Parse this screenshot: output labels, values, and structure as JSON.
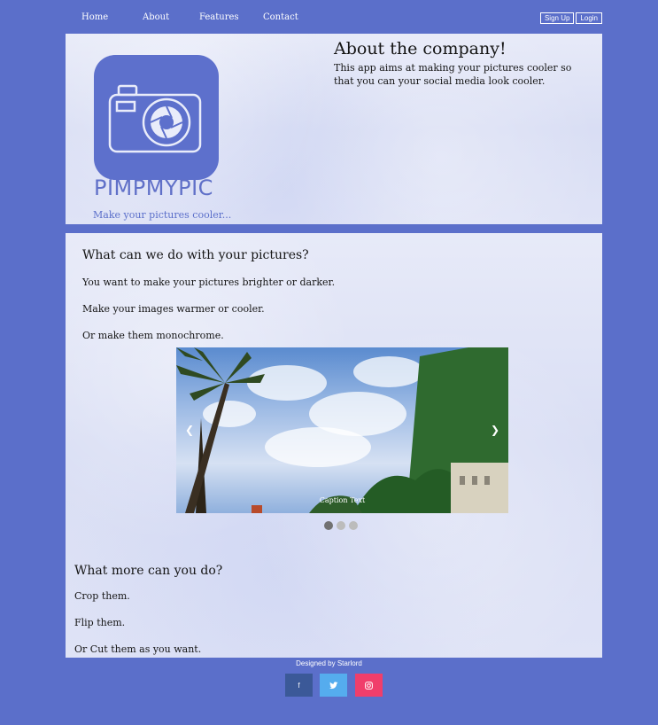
{
  "nav": {
    "items": [
      "Home",
      "About",
      "Features",
      "Contact"
    ],
    "signup_label": "Sign Up",
    "login_label": "Login"
  },
  "hero": {
    "brand": "PIMPMYPIC",
    "tagline": "Make your pictures cooler...",
    "about_title": "About the company!",
    "about_text": "This app aims at making your pictures cooler so that you can your social media look cooler."
  },
  "features": {
    "title": "What can we do with your pictures?",
    "lines": [
      "You want to make your pictures brighter or darker.",
      "Make your images warmer or cooler.",
      "Or make them monochrome."
    ]
  },
  "slideshow": {
    "caption": "Caption Text",
    "prev_symbol": "❮",
    "next_symbol": "❯",
    "active_index": 0,
    "dot_count": 3
  },
  "more": {
    "title": "What more can you do?",
    "lines": [
      "Crop them.",
      "Flip them.",
      "Or Cut them as you want."
    ]
  },
  "footer": {
    "credit": "Designed by Starlord",
    "social": [
      {
        "label": "f",
        "name": "facebook-icon",
        "color": "#3b5998"
      },
      {
        "label": "🐦",
        "name": "twitter-icon",
        "color": "#55acee"
      },
      {
        "label": "◎",
        "name": "instagram-icon",
        "color": "#f03e6b"
      }
    ]
  },
  "colors": {
    "page_background": "#5b6fca",
    "panel_background": "#e1e5f6",
    "brand": "#5d70cc"
  }
}
